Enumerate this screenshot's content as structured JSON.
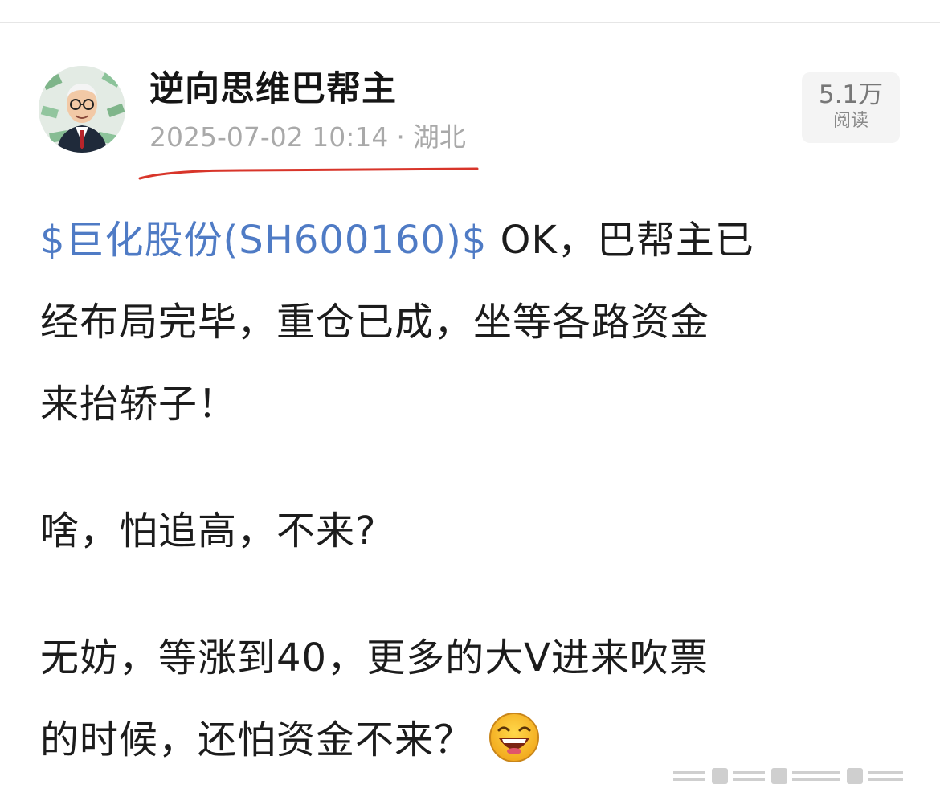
{
  "author": {
    "name": "逆向思维巴帮主",
    "avatar_icon": "avatar-portrait-icon"
  },
  "meta": {
    "date": "2025-07-02 10:14",
    "separator": "·",
    "location": "湖北"
  },
  "read_count": {
    "value": "5.1万",
    "label": "阅读"
  },
  "post": {
    "p1": {
      "stock_link": "$巨化股份(SH600160)$",
      "text_line1_rest": " OK，巴帮主已",
      "text_line2": "经布局完毕，重仓已成，坐等各路资金",
      "text_line3": "来抬轿子！"
    },
    "p2": "啥，怕追高，不来?",
    "p3": {
      "line1": "无妨，等涨到40，更多的大V进来吹票",
      "line2": "的时候，还怕资金不来？",
      "emoji": "laughing-emoji-icon"
    }
  },
  "colors": {
    "link": "#4f7bc5",
    "meta_text": "#a9a9a9",
    "annotation_underline": "#d8352a"
  }
}
